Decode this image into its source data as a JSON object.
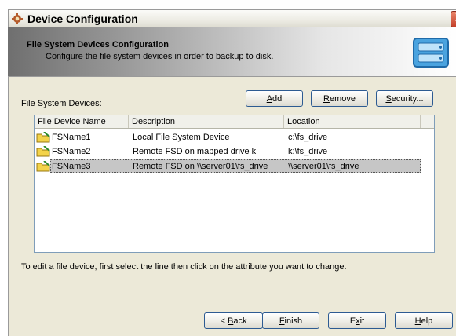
{
  "window": {
    "title": "Device Configuration",
    "close_glyph": "X"
  },
  "banner": {
    "title": "File System Devices Configuration",
    "subtitle": "Configure the file system devices in order to backup to disk."
  },
  "list_label": "File System Devices:",
  "toolbar": {
    "add": {
      "pre": "",
      "key": "A",
      "post": "dd"
    },
    "remove": {
      "pre": "",
      "key": "R",
      "post": "emove"
    },
    "security": {
      "pre": "",
      "key": "S",
      "post": "ecurity..."
    }
  },
  "table": {
    "columns": [
      "File Device Name",
      "Description",
      "Location"
    ],
    "rows": [
      {
        "name": "FSName1",
        "description": "Local File System Device",
        "location": "c:\\fs_drive",
        "selected": false
      },
      {
        "name": "FSName2",
        "description": "Remote FSD on mapped drive k",
        "location": "k:\\fs_drive",
        "selected": false
      },
      {
        "name": "FSName3",
        "description": "Remote FSD on \\\\server01\\fs_drive",
        "location": "\\\\server01\\fs_drive",
        "selected": true
      }
    ]
  },
  "hint": "To edit a file device, first select the line then click on the attribute you want to change.",
  "footer": {
    "back": {
      "pre": "< ",
      "key": "B",
      "post": "ack"
    },
    "finish": {
      "pre": "",
      "key": "F",
      "post": "inish"
    },
    "exit": {
      "pre": "E",
      "key": "x",
      "post": "it"
    },
    "help": {
      "pre": "",
      "key": "H",
      "post": "elp"
    }
  },
  "icons": {
    "app": "app-gear-icon",
    "banner": "drive-config-icon",
    "row": "folder-icon"
  },
  "colors": {
    "selection": "#c6c6c6",
    "panel": "#ece9d8",
    "button_border": "#2d5b92"
  }
}
